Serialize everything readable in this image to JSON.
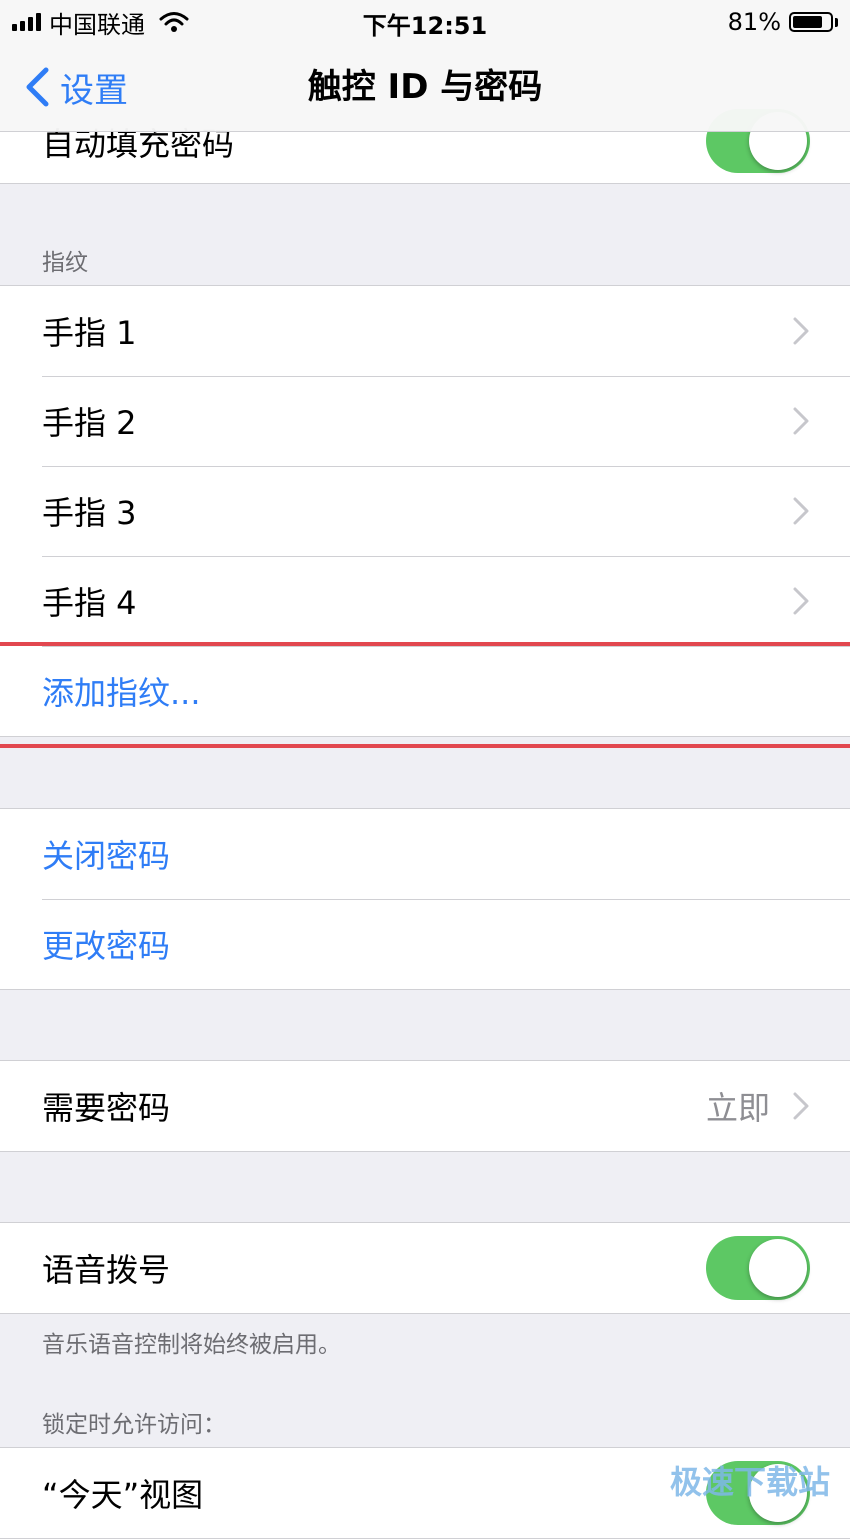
{
  "status_bar": {
    "carrier": "中国联通",
    "time": "下午12:51",
    "battery_percent": "81%",
    "battery_level": 0.81,
    "signal_bars": 4,
    "wifi_icon": "wifi-icon"
  },
  "nav": {
    "back_label": "设置",
    "title": "触控 ID 与密码"
  },
  "top_row": {
    "label": "自动填充密码",
    "toggle_on": true
  },
  "fingerprint_section": {
    "header": "指纹",
    "fingers": [
      {
        "label": "手指 1"
      },
      {
        "label": "手指 2"
      },
      {
        "label": "手指 3"
      },
      {
        "label": "手指 4"
      }
    ],
    "add_label": "添加指纹..."
  },
  "passcode_section": {
    "turn_off": "关闭密码",
    "change": "更改密码"
  },
  "require_section": {
    "label": "需要密码",
    "value": "立即"
  },
  "voice_section": {
    "label": "语音拨号",
    "toggle_on": true,
    "footer": "音乐语音控制将始终被启用。"
  },
  "locked_section": {
    "header": "锁定时允许访问：",
    "today_label": "“今天”视图",
    "toggle_on": true
  },
  "watermark": "极速下载站",
  "colors": {
    "accent_blue": "#2f7df6",
    "toggle_green": "#5dc864",
    "highlight_red": "#e2474f",
    "background": "#efeff4"
  }
}
